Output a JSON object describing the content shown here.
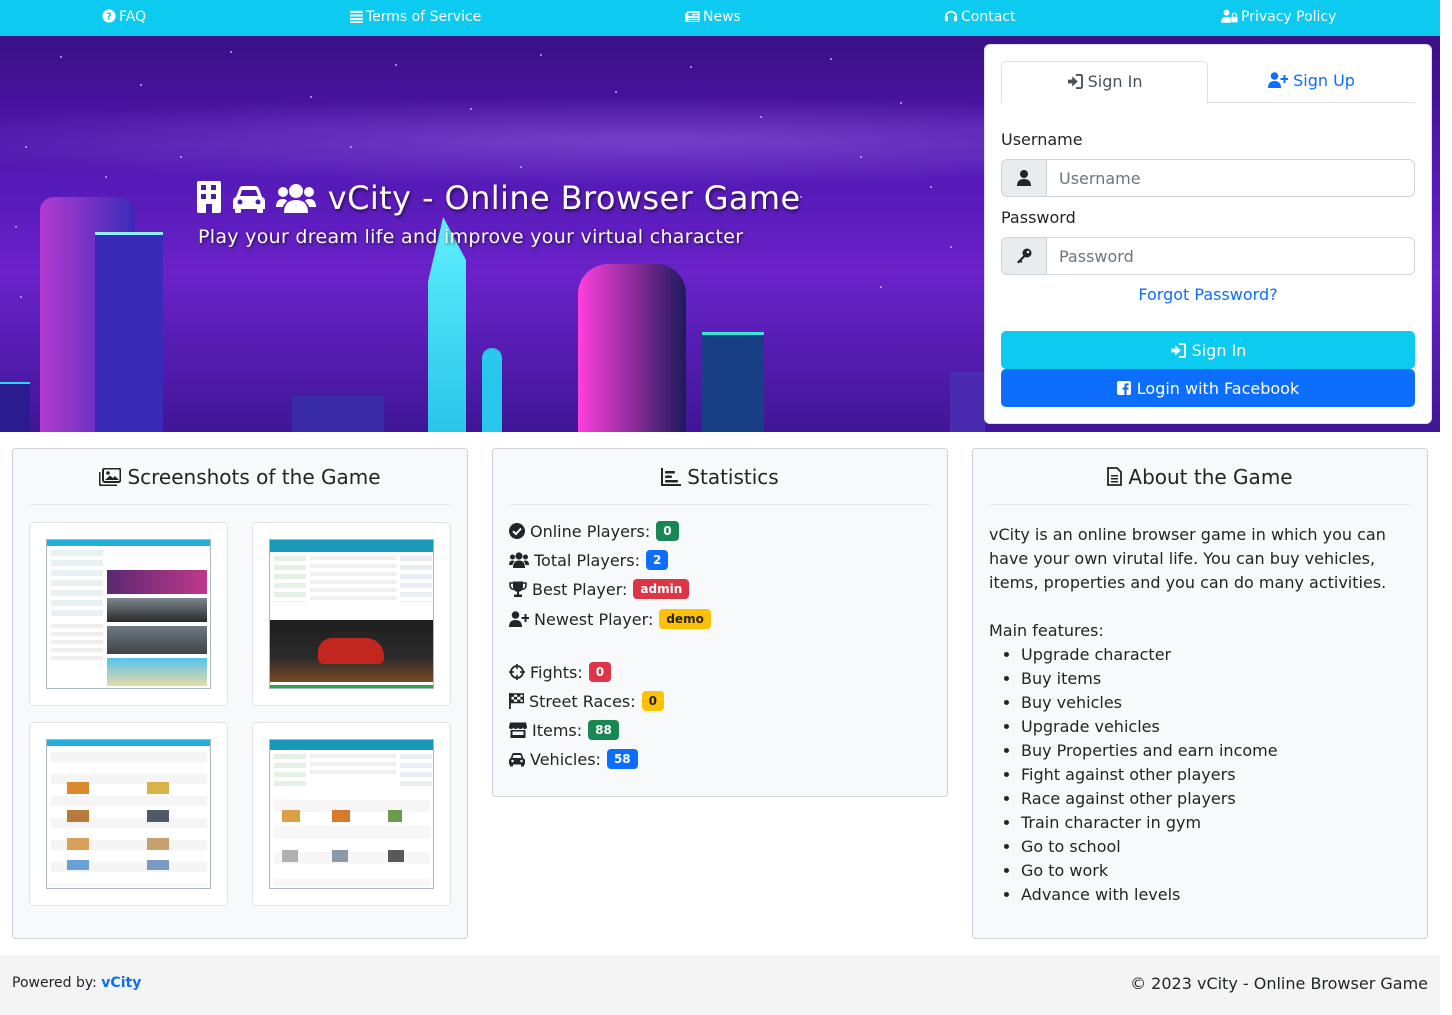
{
  "nav": {
    "faq": "FAQ",
    "terms": "Terms of Service",
    "news": "News",
    "contact": "Contact",
    "privacy": "Privacy Policy"
  },
  "hero": {
    "title": "vCity - Online Browser Game",
    "subtitle": "Play your dream life and improve your virtual character"
  },
  "login": {
    "tab_signin": "Sign In",
    "tab_signup": "Sign Up",
    "username_label": "Username",
    "username_placeholder": "Username",
    "username_value": "",
    "password_label": "Password",
    "password_placeholder": "Password",
    "password_value": "",
    "forgot": "Forgot Password?",
    "signin_button": "Sign In",
    "facebook_button": "Login with Facebook"
  },
  "screenshots": {
    "title": "Screenshots of the Game"
  },
  "statistics": {
    "title": "Statistics",
    "online_label": "Online Players:",
    "online_value": "0",
    "total_label": "Total Players:",
    "total_value": "2",
    "best_label": "Best Player:",
    "best_value": "admin",
    "newest_label": "Newest Player:",
    "newest_value": "demo",
    "fights_label": "Fights:",
    "fights_value": "0",
    "races_label": "Street Races:",
    "races_value": "0",
    "items_label": "Items:",
    "items_value": "88",
    "vehicles_label": "Vehicles:",
    "vehicles_value": "58"
  },
  "about": {
    "title": "About the Game",
    "description": "vCity is an online browser game in which you can have your own virutal life. You can buy vehicles, items, properties and you can do many activities.",
    "features_label": "Main features:",
    "features": [
      "Upgrade character",
      "Buy items",
      "Buy vehicles",
      "Upgrade vehicles",
      "Buy Properties and earn income",
      "Fight against other players",
      "Race against other players",
      "Train character in gym",
      "Go to school",
      "Go to work",
      "Advance with levels"
    ]
  },
  "footer": {
    "powered_label": "Powered by:",
    "powered_link": "vCity",
    "copyright": "© 2023 vCity - Online Browser Game"
  },
  "colors": {
    "nav": "#0dcaf0",
    "primary": "#0d6efd",
    "success": "#198754",
    "danger": "#dc3545",
    "warning": "#ffc107"
  }
}
